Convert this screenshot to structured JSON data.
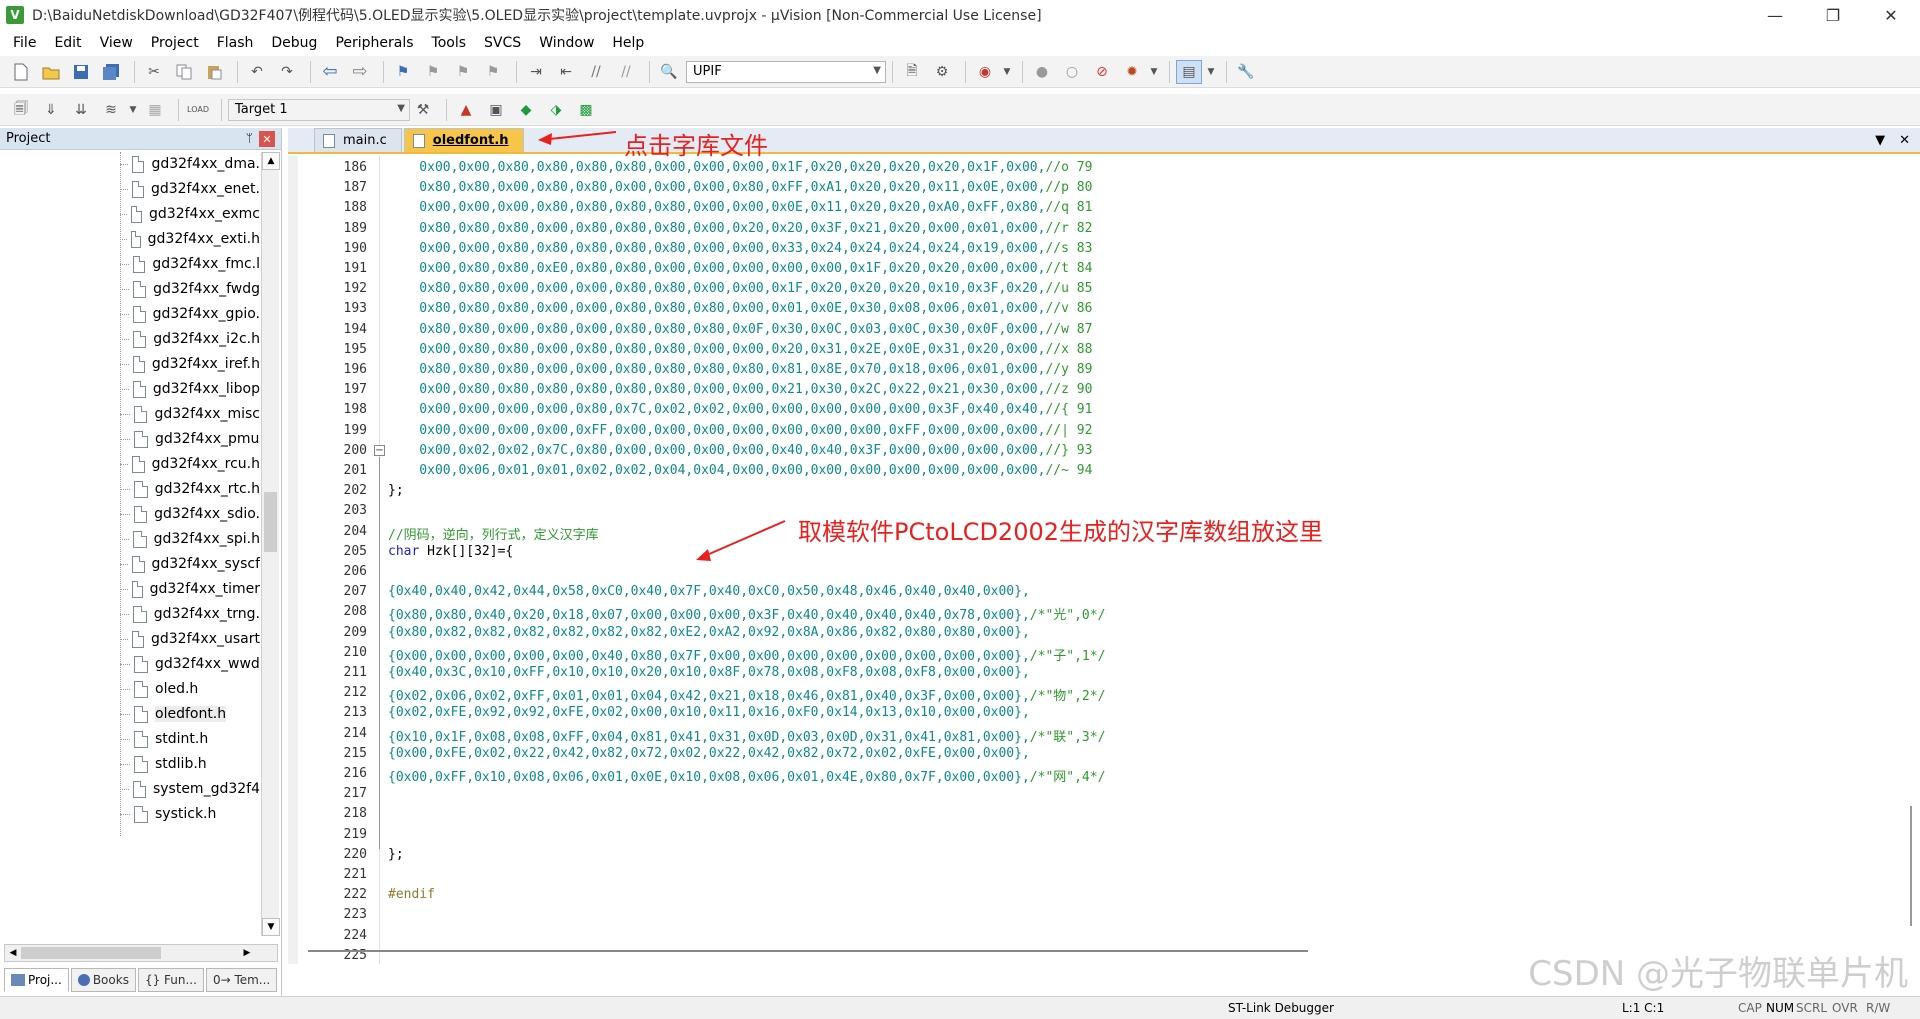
{
  "window": {
    "title": "D:\\BaiduNetdiskDownload\\GD32F407\\例程代码\\5.OLED显示实验\\5.OLED显示实验\\project\\template.uvprojx - µVision  [Non-Commercial Use License]",
    "app_icon": "V",
    "minimize_icon": "—",
    "restore_icon": "❐",
    "close_icon": "✕"
  },
  "menu": [
    "File",
    "Edit",
    "View",
    "Project",
    "Flash",
    "Debug",
    "Peripherals",
    "Tools",
    "SVCS",
    "Window",
    "Help"
  ],
  "toolbar1": {
    "find_combo_value": "UPIF"
  },
  "toolbar2": {
    "target_combo_value": "Target 1",
    "load_label": "LOAD"
  },
  "project_panel": {
    "title": "Project",
    "pin_icon": "📌",
    "close_icon": "✕",
    "files": [
      "gd32f4xx_dma.",
      "gd32f4xx_enet.",
      "gd32f4xx_exmc",
      "gd32f4xx_exti.h",
      "gd32f4xx_fmc.l",
      "gd32f4xx_fwdg",
      "gd32f4xx_gpio.",
      "gd32f4xx_i2c.h",
      "gd32f4xx_iref.h",
      "gd32f4xx_libop",
      "gd32f4xx_misc",
      "gd32f4xx_pmu",
      "gd32f4xx_rcu.h",
      "gd32f4xx_rtc.h",
      "gd32f4xx_sdio.",
      "gd32f4xx_spi.h",
      "gd32f4xx_syscf",
      "gd32f4xx_timer",
      "gd32f4xx_trng.",
      "gd32f4xx_usart",
      "gd32f4xx_wwd",
      "oled.h",
      "oledfont.h",
      "stdint.h",
      "stdlib.h",
      "system_gd32f4",
      "systick.h"
    ],
    "selected_file": "oledfont.h",
    "bottom_tabs": [
      "Proj...",
      "Books",
      "{} Fun...",
      "0→ Tem..."
    ]
  },
  "editor": {
    "tabs": [
      "main.c",
      "oledfont.h"
    ],
    "active_tab": "oledfont.h",
    "menu_arrow": "▼",
    "close_icon": "✕",
    "lines": [
      {
        "n": "186",
        "text": "    0x00,0x00,0x80,0x80,0x80,0x80,0x00,0x00,0x00,0x1F,0x20,0x20,0x20,0x20,0x1F,0x00,//o 79"
      },
      {
        "n": "187",
        "text": "    0x80,0x80,0x00,0x80,0x80,0x00,0x00,0x00,0x80,0xFF,0xA1,0x20,0x20,0x11,0x0E,0x00,//p 80"
      },
      {
        "n": "188",
        "text": "    0x00,0x00,0x00,0x80,0x80,0x80,0x80,0x00,0x00,0x0E,0x11,0x20,0x20,0xA0,0xFF,0x80,//q 81"
      },
      {
        "n": "189",
        "text": "    0x80,0x80,0x80,0x00,0x80,0x80,0x80,0x00,0x20,0x20,0x3F,0x21,0x20,0x00,0x01,0x00,//r 82"
      },
      {
        "n": "190",
        "text": "    0x00,0x00,0x80,0x80,0x80,0x80,0x80,0x00,0x00,0x33,0x24,0x24,0x24,0x24,0x19,0x00,//s 83"
      },
      {
        "n": "191",
        "text": "    0x00,0x80,0x80,0xE0,0x80,0x80,0x00,0x00,0x00,0x00,0x00,0x1F,0x20,0x20,0x00,0x00,//t 84"
      },
      {
        "n": "192",
        "text": "    0x80,0x80,0x00,0x00,0x00,0x80,0x80,0x00,0x00,0x1F,0x20,0x20,0x20,0x10,0x3F,0x20,//u 85"
      },
      {
        "n": "193",
        "text": "    0x80,0x80,0x80,0x00,0x00,0x80,0x80,0x80,0x00,0x01,0x0E,0x30,0x08,0x06,0x01,0x00,//v 86"
      },
      {
        "n": "194",
        "text": "    0x80,0x80,0x00,0x80,0x00,0x80,0x80,0x80,0x0F,0x30,0x0C,0x03,0x0C,0x30,0x0F,0x00,//w 87"
      },
      {
        "n": "195",
        "text": "    0x00,0x80,0x80,0x00,0x80,0x80,0x80,0x00,0x00,0x20,0x31,0x2E,0x0E,0x31,0x20,0x00,//x 88"
      },
      {
        "n": "196",
        "text": "    0x80,0x80,0x80,0x00,0x00,0x80,0x80,0x80,0x80,0x81,0x8E,0x70,0x18,0x06,0x01,0x00,//y 89"
      },
      {
        "n": "197",
        "text": "    0x00,0x80,0x80,0x80,0x80,0x80,0x80,0x00,0x00,0x21,0x30,0x2C,0x22,0x21,0x30,0x00,//z 90"
      },
      {
        "n": "198",
        "text": "    0x00,0x00,0x00,0x00,0x80,0x7C,0x02,0x02,0x00,0x00,0x00,0x00,0x00,0x3F,0x40,0x40,//{ 91"
      },
      {
        "n": "199",
        "text": "    0x00,0x00,0x00,0x00,0xFF,0x00,0x00,0x00,0x00,0x00,0x00,0x00,0xFF,0x00,0x00,0x00,//| 92"
      },
      {
        "n": "200",
        "text": "    0x00,0x02,0x02,0x7C,0x80,0x00,0x00,0x00,0x00,0x40,0x40,0x3F,0x00,0x00,0x00,0x00,//} 93"
      },
      {
        "n": "201",
        "text": "    0x00,0x06,0x01,0x01,0x02,0x02,0x04,0x04,0x00,0x00,0x00,0x00,0x00,0x00,0x00,0x00,//~ 94"
      },
      {
        "n": "202",
        "text": "};"
      },
      {
        "n": "203",
        "text": ""
      },
      {
        "n": "204",
        "text": "//阴码，逆向，列行式，定义汉字库"
      },
      {
        "n": "205",
        "text": "char Hzk[][32]={"
      },
      {
        "n": "206",
        "text": ""
      },
      {
        "n": "207",
        "text": "{0x40,0x40,0x42,0x44,0x58,0xC0,0x40,0x7F,0x40,0xC0,0x50,0x48,0x46,0x40,0x40,0x00},"
      },
      {
        "n": "208",
        "text": "{0x80,0x80,0x40,0x20,0x18,0x07,0x00,0x00,0x00,0x3F,0x40,0x40,0x40,0x40,0x78,0x00},/*\"光\",0*/"
      },
      {
        "n": "209",
        "text": "{0x80,0x82,0x82,0x82,0x82,0x82,0x82,0xE2,0xA2,0x92,0x8A,0x86,0x82,0x80,0x80,0x00},"
      },
      {
        "n": "210",
        "text": "{0x00,0x00,0x00,0x00,0x00,0x40,0x80,0x7F,0x00,0x00,0x00,0x00,0x00,0x00,0x00,0x00},/*\"子\",1*/"
      },
      {
        "n": "211",
        "text": "{0x40,0x3C,0x10,0xFF,0x10,0x10,0x20,0x10,0x8F,0x78,0x08,0xF8,0x08,0xF8,0x00,0x00},"
      },
      {
        "n": "212",
        "text": "{0x02,0x06,0x02,0xFF,0x01,0x01,0x04,0x42,0x21,0x18,0x46,0x81,0x40,0x3F,0x00,0x00},/*\"物\",2*/"
      },
      {
        "n": "213",
        "text": "{0x02,0xFE,0x92,0x92,0xFE,0x02,0x00,0x10,0x11,0x16,0xF0,0x14,0x13,0x10,0x00,0x00},"
      },
      {
        "n": "214",
        "text": "{0x10,0x1F,0x08,0x08,0xFF,0x04,0x81,0x41,0x31,0x0D,0x03,0x0D,0x31,0x41,0x81,0x00},/*\"联\",3*/"
      },
      {
        "n": "215",
        "text": "{0x00,0xFE,0x02,0x22,0x42,0x82,0x72,0x02,0x22,0x42,0x82,0x72,0x02,0xFE,0x00,0x00},"
      },
      {
        "n": "216",
        "text": "{0x00,0xFF,0x10,0x08,0x06,0x01,0x0E,0x10,0x08,0x06,0x01,0x4E,0x80,0x7F,0x00,0x00},/*\"网\",4*/"
      },
      {
        "n": "217",
        "text": ""
      },
      {
        "n": "218",
        "text": ""
      },
      {
        "n": "219",
        "text": ""
      },
      {
        "n": "220",
        "text": "};"
      },
      {
        "n": "221",
        "text": ""
      },
      {
        "n": "222",
        "text": "#endif"
      },
      {
        "n": "223",
        "text": ""
      },
      {
        "n": "224",
        "text": ""
      },
      {
        "n": "225",
        "text": ""
      }
    ]
  },
  "annotations": {
    "tab_hint": "点击字库文件",
    "code_hint": "取模软件PCtoLCD2002生成的汉字库数组放这里",
    "color": "#e8211e"
  },
  "statusbar": {
    "debugger": "ST-Link Debugger",
    "position": "L:1 C:1",
    "flags": [
      "CAP",
      "NUM",
      "SCRL",
      "OVR",
      "R/W"
    ]
  },
  "watermark": "CSDN @光子物联单片机"
}
